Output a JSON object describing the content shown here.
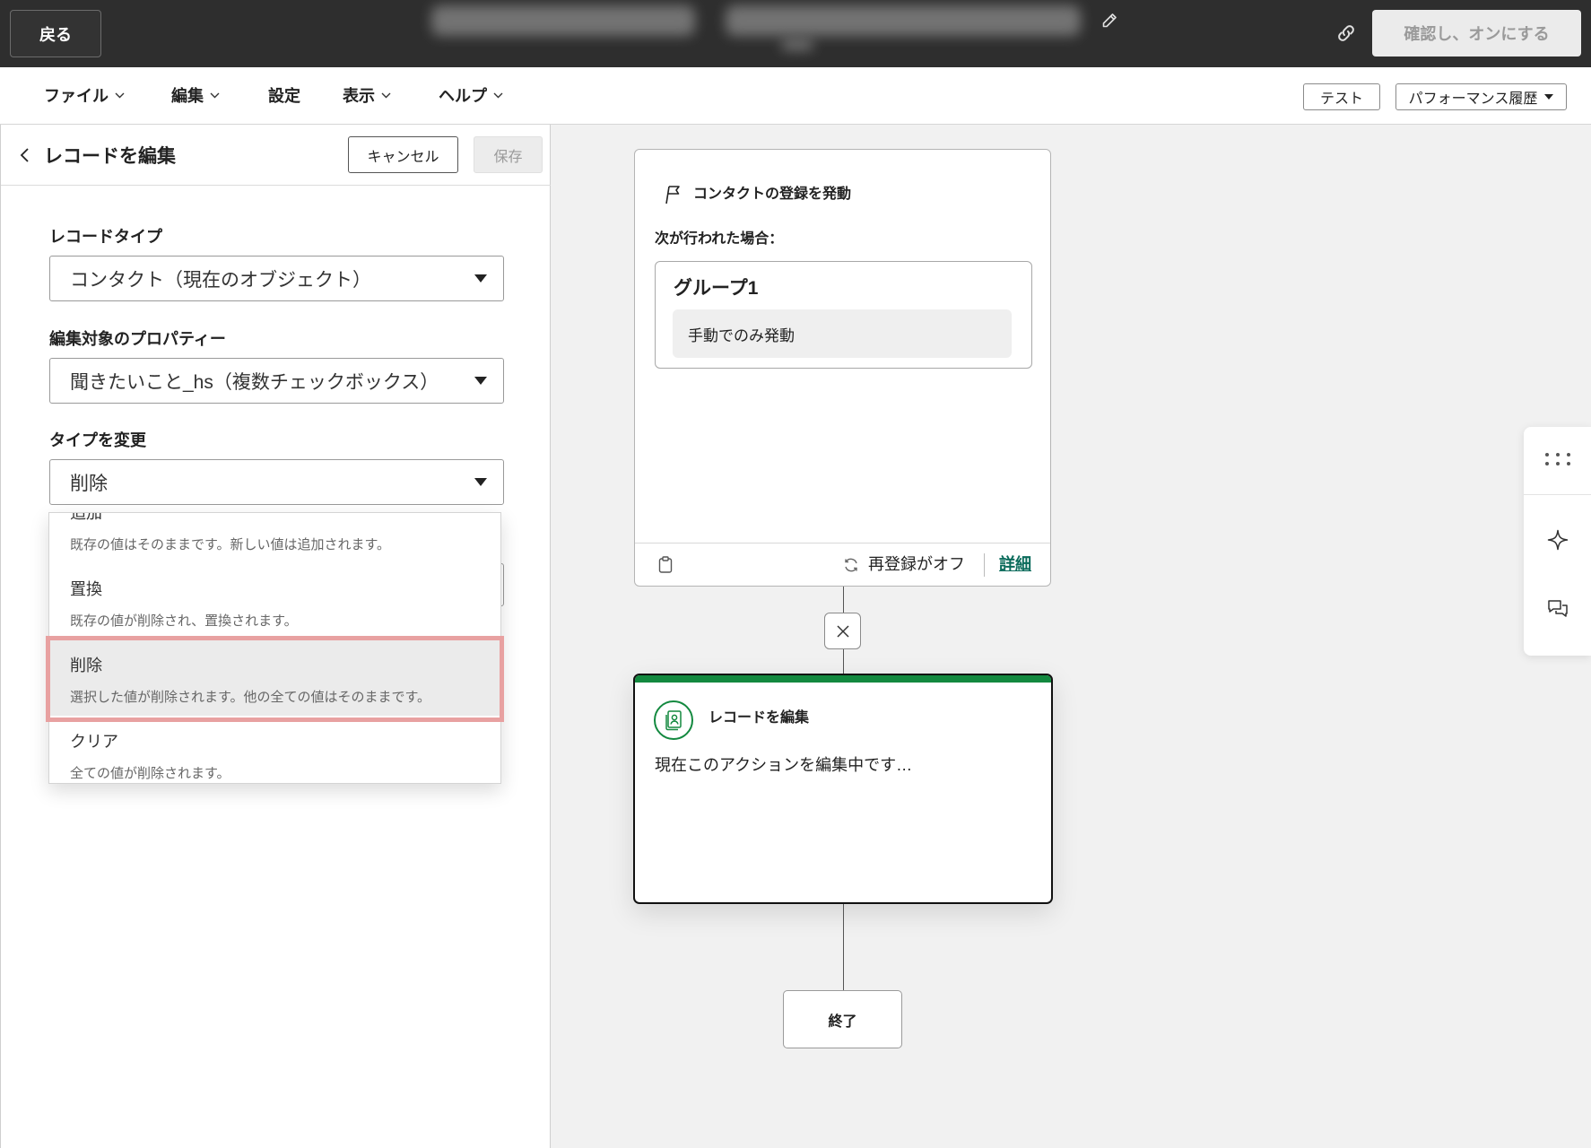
{
  "topbar": {
    "back_label": "戻る",
    "confirm_label": "確認し、オンにする"
  },
  "menu": {
    "items": [
      {
        "label": "ファイル",
        "has_dropdown": true
      },
      {
        "label": "編集",
        "has_dropdown": true
      },
      {
        "label": "設定",
        "has_dropdown": false
      },
      {
        "label": "表示",
        "has_dropdown": true
      },
      {
        "label": "ヘルプ",
        "has_dropdown": true
      }
    ],
    "test_label": "テスト",
    "performance_label": "パフォーマンス履歴"
  },
  "panel": {
    "title": "レコードを編集",
    "cancel_label": "キャンセル",
    "save_label": "保存",
    "fields": [
      {
        "label": "レコードタイプ",
        "value": "コンタクト（現在のオブジェクト）"
      },
      {
        "label": "編集対象のプロパティー",
        "value": "聞きたいこと_hs（複数チェックボックス）"
      },
      {
        "label": "タイプを変更",
        "value": "削除"
      }
    ],
    "dropdown": {
      "selected": "削除",
      "options": [
        {
          "title": "追加",
          "description": "既存の値はそのままです。新しい値は追加されます。"
        },
        {
          "title": "置換",
          "description": "既存の値が削除され、置換されます。"
        },
        {
          "title": "削除",
          "description": "選択した値が削除されます。他の全ての値はそのままです。"
        },
        {
          "title": "クリア",
          "description": "全ての値が削除されます。"
        }
      ]
    }
  },
  "canvas": {
    "trigger": {
      "title": "コンタクトの登録を発動",
      "condition_label": "次が行われた場合：",
      "group_title": "グループ1",
      "group_item": "手動でのみ発動",
      "reenroll_status": "再登録がオフ",
      "details_link": "詳細"
    },
    "action": {
      "title": "レコードを編集",
      "status": "現在このアクションを編集中です…"
    },
    "end_label": "終了"
  },
  "icons": {
    "title_edit": "pencil-icon",
    "topbar_link": "link-icon",
    "trigger": "flag-icon",
    "trigger_footer": [
      "clipboard-icon",
      "refresh-icon"
    ],
    "connector": "close-icon",
    "action": "contact-record-icon",
    "right_toolbar": [
      "dots-grid-icon",
      "sparkle-icon",
      "chat-icon"
    ]
  },
  "colors": {
    "topbar_bg": "#2e2e2e",
    "accent_green": "#13893f",
    "link_teal": "#0a6b5b",
    "highlight_annotation": "#e8a1a1",
    "canvas_bg": "#f1f1f1"
  }
}
